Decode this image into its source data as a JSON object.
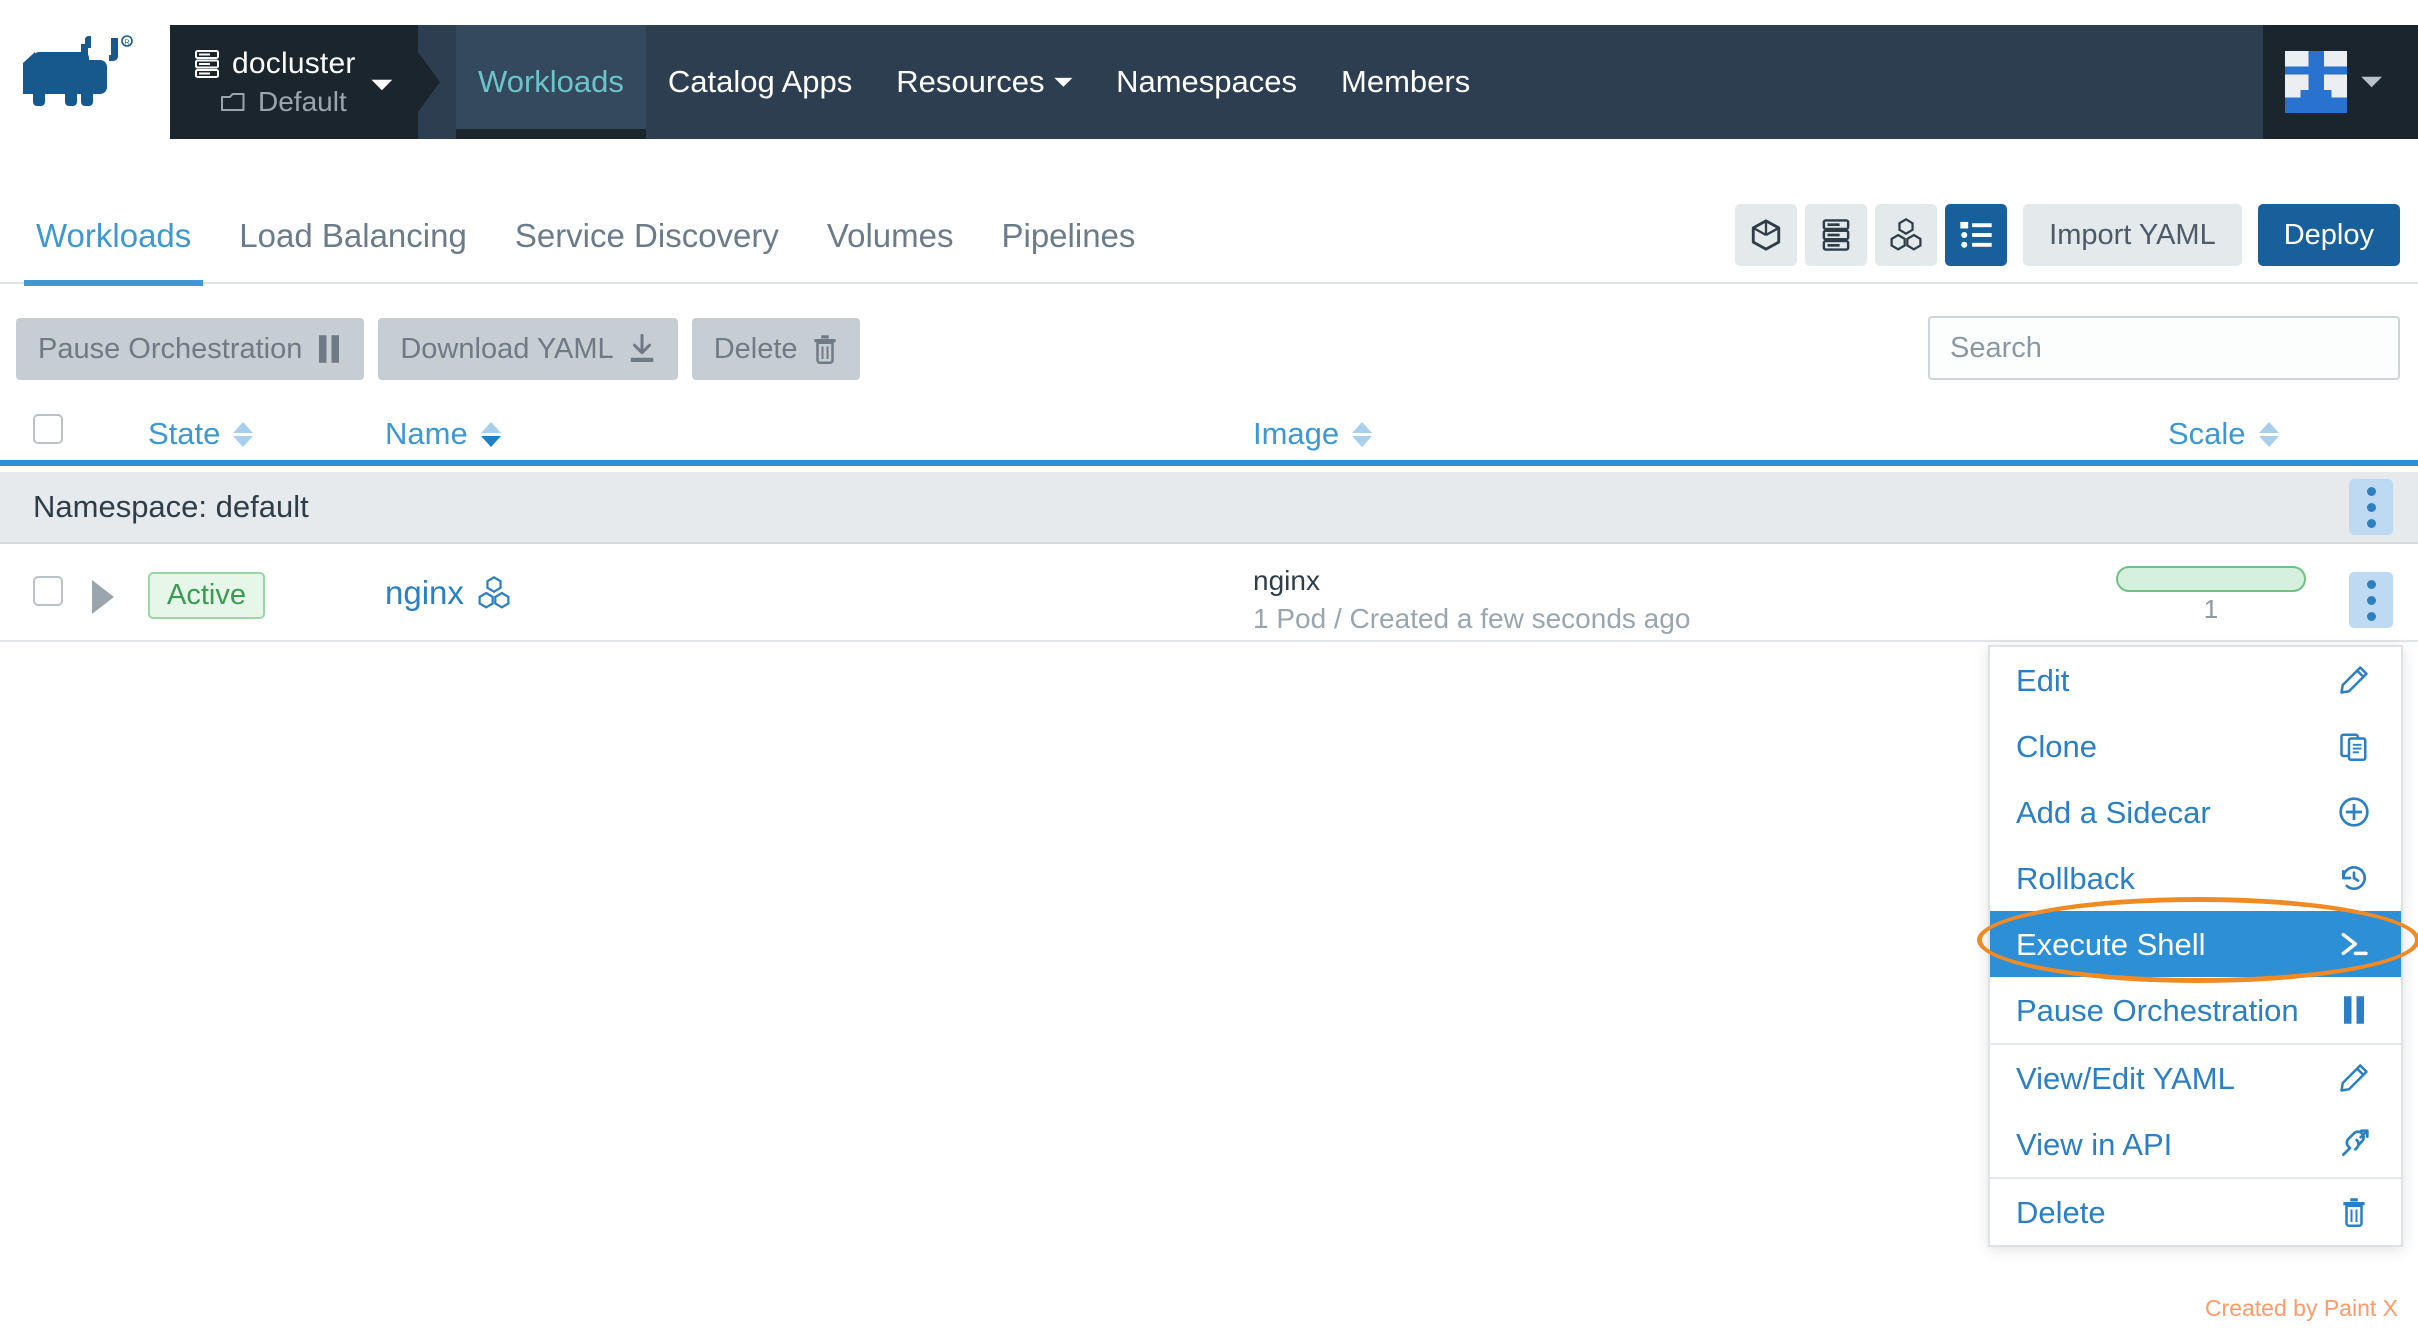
{
  "header": {
    "logo_icon": "rancher-cow-logo",
    "cluster": {
      "icon": "server-rack-icon",
      "name": "docluster"
    },
    "project": {
      "icon": "folder-icon",
      "name": "Default"
    },
    "nav": [
      {
        "label": "Workloads",
        "active": true
      },
      {
        "label": "Catalog Apps",
        "active": false
      },
      {
        "label": "Resources",
        "active": false,
        "caret": "⌄"
      },
      {
        "label": "Namespaces",
        "active": false
      },
      {
        "label": "Members",
        "active": false
      }
    ],
    "user": {
      "avatar_icon": "user-identicon-avatar",
      "chevron": "⌄"
    }
  },
  "tabs": [
    {
      "label": "Workloads",
      "active": true
    },
    {
      "label": "Load Balancing",
      "active": false
    },
    {
      "label": "Service Discovery",
      "active": false
    },
    {
      "label": "Volumes",
      "active": false
    },
    {
      "label": "Pipelines",
      "active": false
    }
  ],
  "view_toggles": [
    {
      "icon": "cube-icon",
      "active": false
    },
    {
      "icon": "server-stack-icon",
      "active": false
    },
    {
      "icon": "nodes-cluster-icon",
      "active": false
    },
    {
      "icon": "list-view-icon",
      "active": true
    }
  ],
  "toolbar": {
    "import_yaml_label": "Import YAML",
    "deploy_label": "Deploy"
  },
  "actions": {
    "pause_label": "Pause Orchestration",
    "download_label": "Download YAML",
    "delete_label": "Delete"
  },
  "search": {
    "placeholder": "Search",
    "value": ""
  },
  "table": {
    "columns": [
      {
        "label": "State",
        "sorted": false
      },
      {
        "label": "Name",
        "sorted": true
      },
      {
        "label": "Image",
        "sorted": false
      },
      {
        "label": "Scale",
        "sorted": false
      }
    ],
    "group_label": "Namespace: default",
    "rows": [
      {
        "state": "Active",
        "name": "nginx",
        "name_icon": "workload-icon",
        "image": "nginx",
        "image_sub": "1 Pod / Created a few seconds ago",
        "scale": "1"
      }
    ]
  },
  "context_menu": {
    "items": [
      {
        "label": "Edit",
        "icon": "pencil-icon",
        "selected": false,
        "separator_after": false
      },
      {
        "label": "Clone",
        "icon": "clipboard-copy-icon",
        "selected": false,
        "separator_after": false
      },
      {
        "label": "Add a Sidecar",
        "icon": "plus-circle-icon",
        "selected": false,
        "separator_after": false
      },
      {
        "label": "Rollback",
        "icon": "history-clock-icon",
        "selected": false,
        "separator_after": false
      },
      {
        "label": "Execute Shell",
        "icon": "terminal-icon",
        "selected": true,
        "separator_after": false
      },
      {
        "label": "Pause Orchestration",
        "icon": "pause-icon",
        "selected": false,
        "separator_after": true
      },
      {
        "label": "View/Edit YAML",
        "icon": "pencil-icon",
        "selected": false,
        "separator_after": false
      },
      {
        "label": "View in API",
        "icon": "api-link-icon",
        "selected": false,
        "separator_after": true
      },
      {
        "label": "Delete",
        "icon": "trash-icon",
        "selected": false,
        "separator_after": false
      }
    ],
    "highlight": {
      "target": "Execute Shell",
      "shape": "ellipse",
      "color": "#f08a24"
    }
  },
  "watermark": {
    "text": "Created by Paint X",
    "color": "#ff9a6a"
  },
  "colors": {
    "header_bg": "#2c3e50",
    "header_dark": "#1b252e",
    "accent_blue": "#2b7fc4",
    "deploy_blue": "#18609c",
    "active_teal": "#6bc4c9",
    "state_green": "#3a9b52",
    "highlight_orange": "#f08a24"
  }
}
